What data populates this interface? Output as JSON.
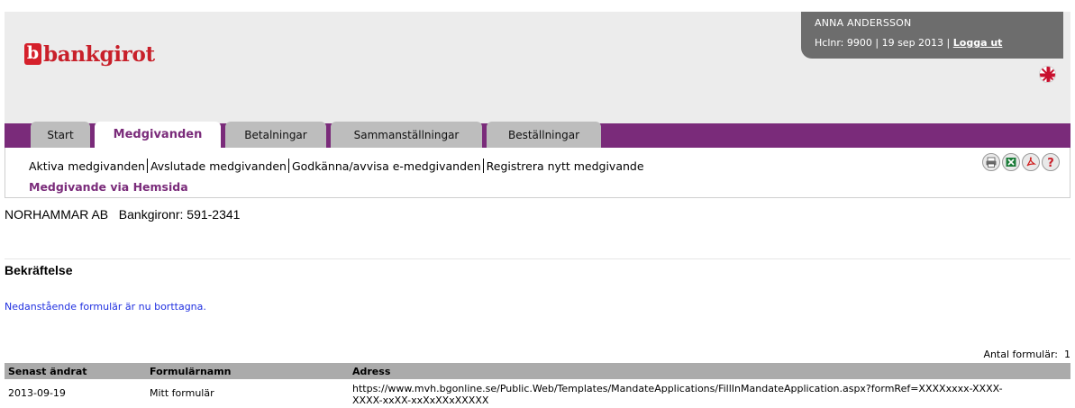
{
  "brand": {
    "name": "bankgirot",
    "mark": "b",
    "color": "#c8202a"
  },
  "user": {
    "name": "ANNA ANDERSSON",
    "hclnr": "Hclnr: 9900",
    "date": "19 sep 2013",
    "logout": "Logga ut"
  },
  "language_icon": "uk-flag-icon",
  "tabs": [
    {
      "label": "Start",
      "active": false
    },
    {
      "label": "Medgivanden",
      "active": true
    },
    {
      "label": "Betalningar",
      "active": false
    },
    {
      "label": "Sammanställningar",
      "active": false
    },
    {
      "label": "Beställningar",
      "active": false
    }
  ],
  "subnav": {
    "links": [
      "Aktiva medgivanden",
      "Avslutade medgivanden",
      "Godkänna/avvisa e-medgivanden",
      "Registrera nytt medgivande"
    ],
    "active": "Medgivande via Hemsida"
  },
  "toolbar_icons": [
    "print-icon",
    "excel-icon",
    "pdf-icon",
    "help-icon"
  ],
  "company": {
    "name": "NORHAMMAR AB",
    "bankgiro": "Bankgironr: 591-2341"
  },
  "section": {
    "title": "Bekräftelse",
    "message": "Nedanstående formulär är nu borttagna."
  },
  "table": {
    "count_label": "Antal formulär:",
    "count": "1",
    "columns": [
      "Senast ändrat",
      "Formulärnamn",
      "Adress"
    ],
    "rows": [
      {
        "date": "2013-09-19",
        "name": "Mitt formulär",
        "address": "https://www.mvh.bgonline.se/Public.Web/Templates/MandateApplications/FillInMandateApplication.aspx?formRef=XXXXxxxx-XXXX-XXXX-xxXX-xxXxXXxXXXXX"
      }
    ]
  },
  "colors": {
    "purple": "#7a2b7a",
    "link_blue": "#1f2fe0",
    "header_gray": "#ececec",
    "userbox_gray": "#6d6d6d"
  }
}
